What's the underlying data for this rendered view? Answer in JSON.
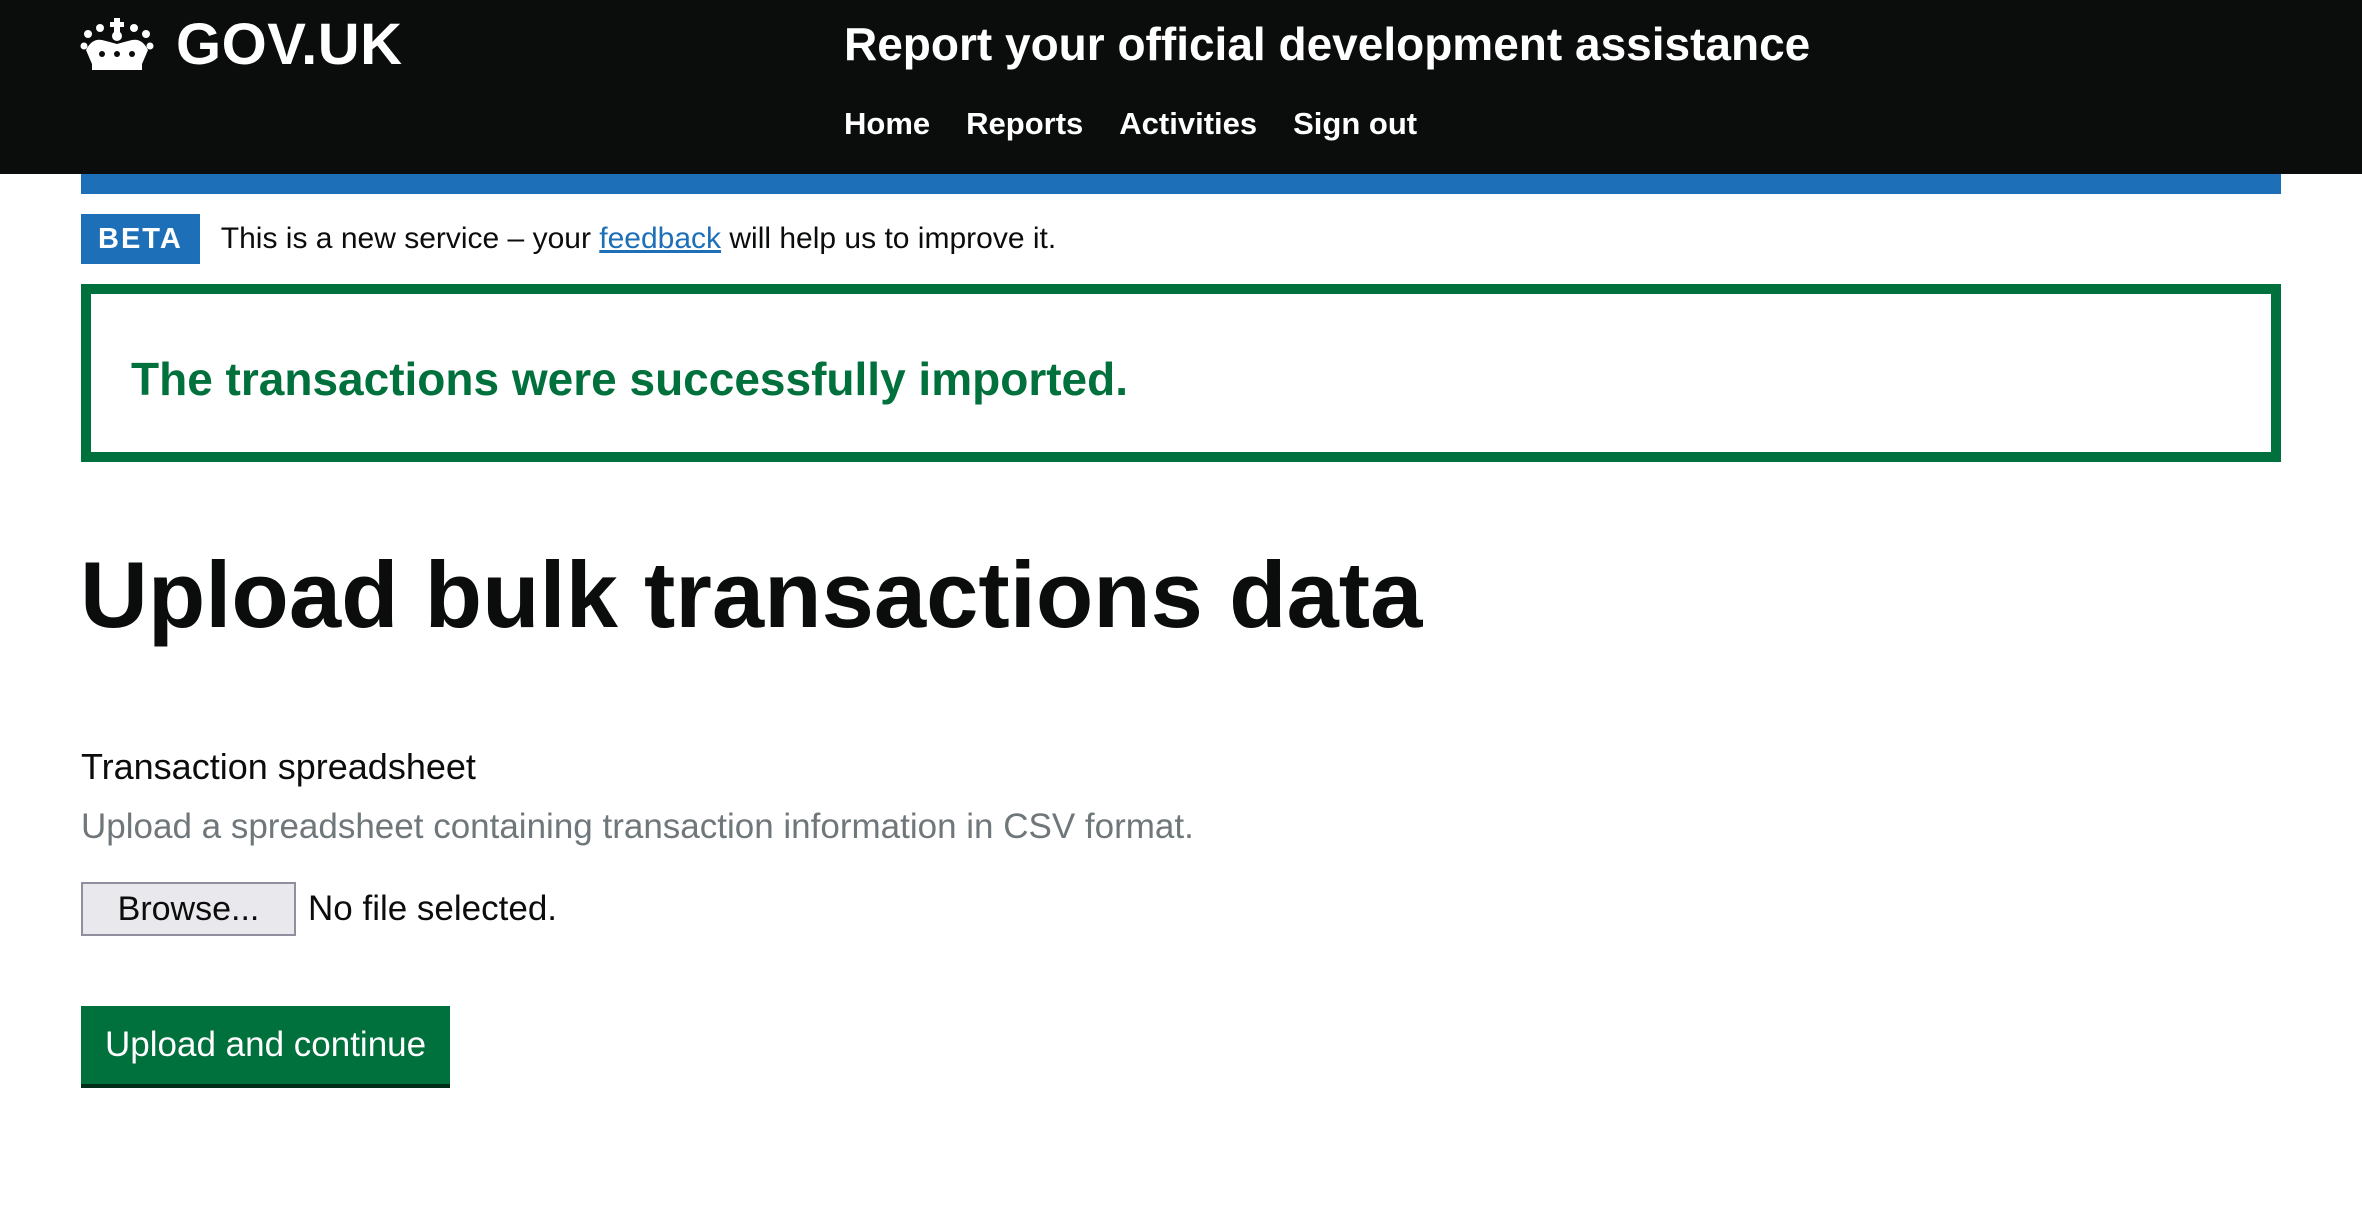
{
  "header": {
    "logo_text": "GOV.UK",
    "logo_icon": "crown-icon",
    "service_name": "Report your official development assistance",
    "nav": [
      {
        "label": "Home"
      },
      {
        "label": "Reports"
      },
      {
        "label": "Activities"
      },
      {
        "label": "Sign out"
      }
    ]
  },
  "phase_banner": {
    "tag": "BETA",
    "text_before": "This is a new service – your ",
    "link": "feedback",
    "text_after": " will help us to improve it."
  },
  "notification": {
    "heading": "The transactions were successfully imported."
  },
  "page": {
    "title": "Upload bulk transactions data"
  },
  "form": {
    "label": "Transaction spreadsheet",
    "hint": "Upload a spreadsheet containing transaction information in CSV format.",
    "browse_label": "Browse...",
    "file_status": "No file selected.",
    "submit_label": "Upload and continue"
  },
  "colors": {
    "header_bg": "#0b0c0c",
    "brand_blue": "#1d70b8",
    "success_green": "#00703c",
    "hint_grey": "#6f777b"
  }
}
